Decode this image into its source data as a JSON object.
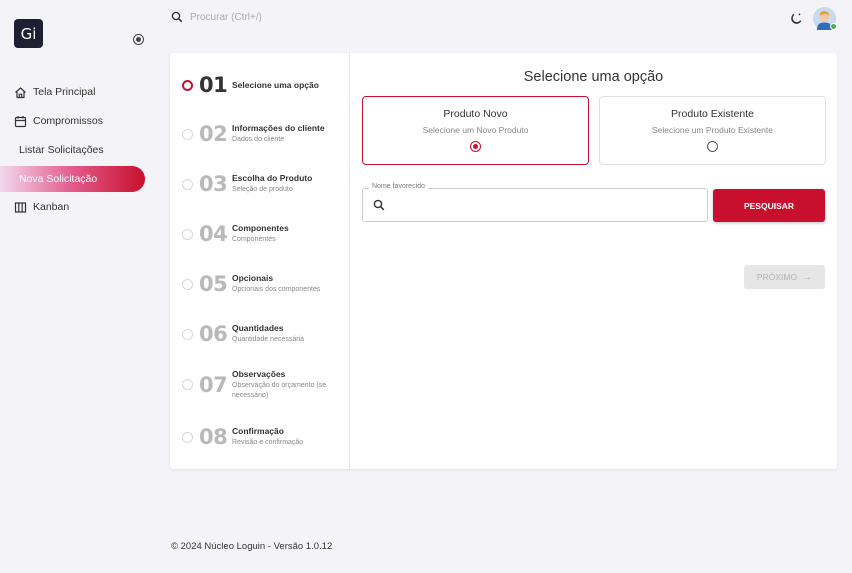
{
  "app": {
    "logo_text": "Gi"
  },
  "header": {
    "search_placeholder": "Procurar (Ctrl+/)"
  },
  "sidebar": {
    "items": [
      {
        "label": "Tela Principal",
        "icon": "home-icon"
      },
      {
        "label": "Compromissos",
        "icon": "calendar-icon"
      },
      {
        "label": "Listar Solicitações"
      },
      {
        "label": "Nova Solicitação",
        "active": true
      },
      {
        "label": "Kanban",
        "icon": "kanban-icon"
      }
    ]
  },
  "steps": [
    {
      "num": "01",
      "title": "Selecione uma opção",
      "desc": "",
      "active": true
    },
    {
      "num": "02",
      "title": "Informações do cliente",
      "desc": "Dados do cliente"
    },
    {
      "num": "03",
      "title": "Escolha do Produto",
      "desc": "Seleção de produto"
    },
    {
      "num": "04",
      "title": "Componentes",
      "desc": "Componentes"
    },
    {
      "num": "05",
      "title": "Opcionais",
      "desc": "Opcionais dos componentes"
    },
    {
      "num": "06",
      "title": "Quantidades",
      "desc": "Quantidade necessária"
    },
    {
      "num": "07",
      "title": "Observações",
      "desc": "Observação do orçamento (se necessário)"
    },
    {
      "num": "08",
      "title": "Confirmação",
      "desc": "Revisão e confirmação"
    }
  ],
  "content": {
    "title": "Selecione uma opção",
    "options": [
      {
        "title": "Produto Novo",
        "desc": "Selecione um Novo Produto",
        "selected": true
      },
      {
        "title": "Produto Existente",
        "desc": "Selecione um Produto Existente",
        "selected": false
      }
    ],
    "fav_label": "Nome favorecido",
    "fav_value": "",
    "search_button": "PESQUISAR",
    "next_button": "PRÓXIMO"
  },
  "footer": {
    "text": "© 2024 Núcleo Loguin - Versão 1.0.12"
  },
  "colors": {
    "accent": "#c8102e",
    "logo_bg": "#1e1f33",
    "page_bg": "#f4f4f8"
  }
}
